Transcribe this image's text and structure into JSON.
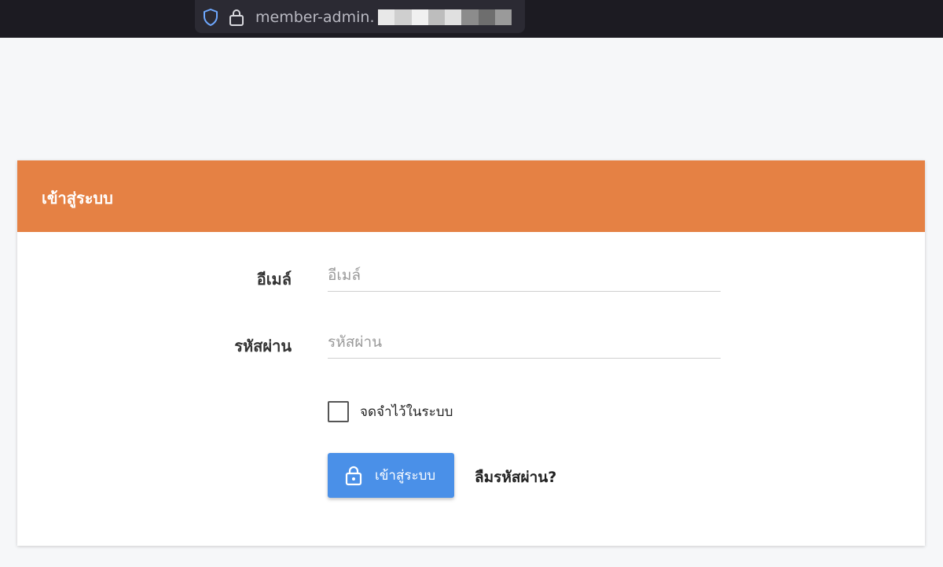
{
  "browser": {
    "url_text": "member-admin.",
    "url_blur_colors": [
      "#e8e8e8",
      "#cfcfcf",
      "#f0f0f0",
      "#bdbdbd",
      "#e0e0e0",
      "#8c8c8c",
      "#6e6e6e",
      "#9a9a9a"
    ],
    "shield_color": "#6ea8ff"
  },
  "login": {
    "header_title": "เข้าสู่ระบบ",
    "header_color": "#e58144",
    "email_label": "อีเมล์",
    "email_placeholder": "อีเมล์",
    "email_value": "",
    "password_label": "รหัสผ่าน",
    "password_placeholder": "รหัสผ่าน",
    "password_value": "",
    "remember_label": "จดจำไว้ในระบบ",
    "remember_checked": false,
    "submit_label": "เข้าสู่ระบบ",
    "submit_color": "#4a90e8",
    "forgot_label": "ลืมรหัสผ่าน?"
  }
}
